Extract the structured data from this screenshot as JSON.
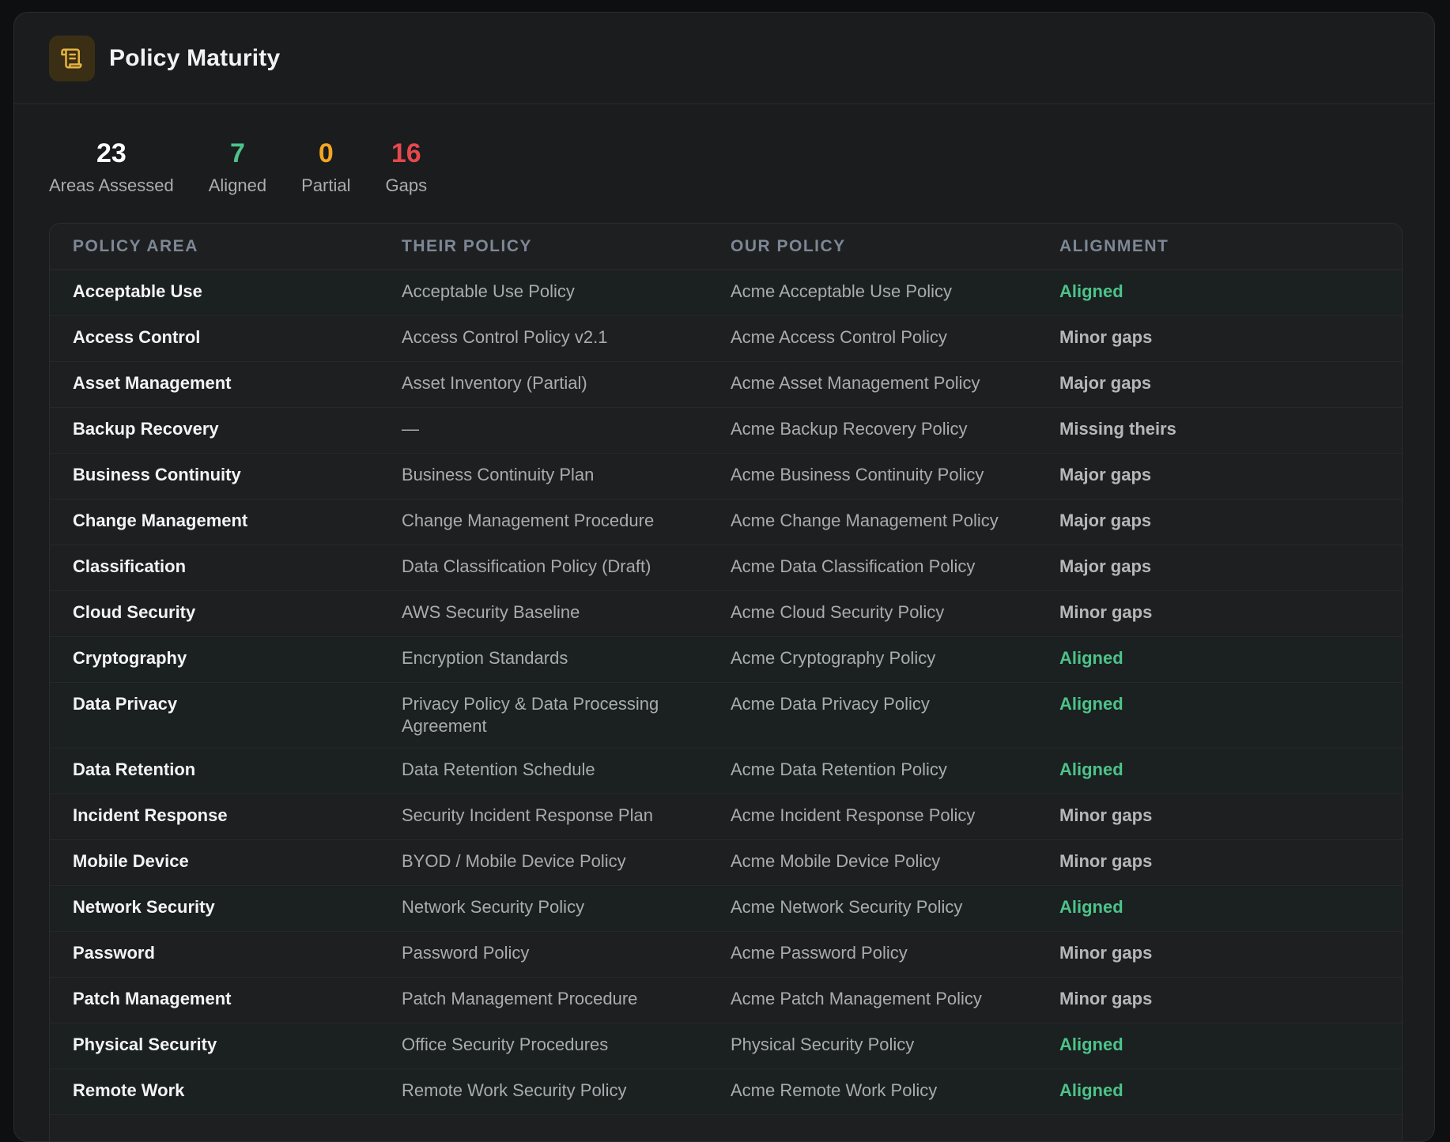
{
  "header": {
    "title": "Policy Maturity",
    "icon": "scroll-icon"
  },
  "colors": {
    "aligned": "#4cc38a",
    "partial": "#f2a623",
    "gaps": "#e5484d",
    "icon_accent": "#e6b341"
  },
  "stats": [
    {
      "value": "23",
      "label": "Areas Assessed",
      "color": "#ffffff"
    },
    {
      "value": "7",
      "label": "Aligned",
      "color": "#4cc38a"
    },
    {
      "value": "0",
      "label": "Partial",
      "color": "#f2a623"
    },
    {
      "value": "16",
      "label": "Gaps",
      "color": "#e5484d"
    }
  ],
  "table": {
    "columns": [
      "POLICY AREA",
      "THEIR POLICY",
      "OUR POLICY",
      "ALIGNMENT"
    ],
    "rows": [
      {
        "area": "Acceptable Use",
        "theirs": "Acceptable Use Policy",
        "ours": "Acme Acceptable Use Policy",
        "alignment": "Aligned"
      },
      {
        "area": "Access Control",
        "theirs": "Access Control Policy v2.1",
        "ours": "Acme Access Control Policy",
        "alignment": "Minor gaps"
      },
      {
        "area": "Asset Management",
        "theirs": "Asset Inventory (Partial)",
        "ours": "Acme Asset Management Policy",
        "alignment": "Major gaps"
      },
      {
        "area": "Backup Recovery",
        "theirs": "—",
        "ours": "Acme Backup Recovery Policy",
        "alignment": "Missing theirs"
      },
      {
        "area": "Business Continuity",
        "theirs": "Business Continuity Plan",
        "ours": "Acme Business Continuity Policy",
        "alignment": "Major gaps"
      },
      {
        "area": "Change Management",
        "theirs": "Change Management Procedure",
        "ours": "Acme Change Management Policy",
        "alignment": "Major gaps"
      },
      {
        "area": "Classification",
        "theirs": "Data Classification Policy (Draft)",
        "ours": "Acme Data Classification Policy",
        "alignment": "Major gaps"
      },
      {
        "area": "Cloud Security",
        "theirs": "AWS Security Baseline",
        "ours": "Acme Cloud Security Policy",
        "alignment": "Minor gaps"
      },
      {
        "area": "Cryptography",
        "theirs": "Encryption Standards",
        "ours": "Acme Cryptography Policy",
        "alignment": "Aligned"
      },
      {
        "area": "Data Privacy",
        "theirs": "Privacy Policy & Data Processing Agreement",
        "ours": "Acme Data Privacy Policy",
        "alignment": "Aligned"
      },
      {
        "area": "Data Retention",
        "theirs": "Data Retention Schedule",
        "ours": "Acme Data Retention Policy",
        "alignment": "Aligned"
      },
      {
        "area": "Incident Response",
        "theirs": "Security Incident Response Plan",
        "ours": "Acme Incident Response Policy",
        "alignment": "Minor gaps"
      },
      {
        "area": "Mobile Device",
        "theirs": "BYOD / Mobile Device Policy",
        "ours": "Acme Mobile Device Policy",
        "alignment": "Minor gaps"
      },
      {
        "area": "Network Security",
        "theirs": "Network Security Policy",
        "ours": "Acme Network Security Policy",
        "alignment": "Aligned"
      },
      {
        "area": "Password",
        "theirs": "Password Policy",
        "ours": "Acme Password Policy",
        "alignment": "Minor gaps"
      },
      {
        "area": "Patch Management",
        "theirs": "Patch Management Procedure",
        "ours": "Acme Patch Management Policy",
        "alignment": "Minor gaps"
      },
      {
        "area": "Physical Security",
        "theirs": "Office Security Procedures",
        "ours": "Physical Security Policy",
        "alignment": "Aligned"
      },
      {
        "area": "Remote Work",
        "theirs": "Remote Work Security Policy",
        "ours": "Acme Remote Work Policy",
        "alignment": "Aligned"
      }
    ]
  }
}
